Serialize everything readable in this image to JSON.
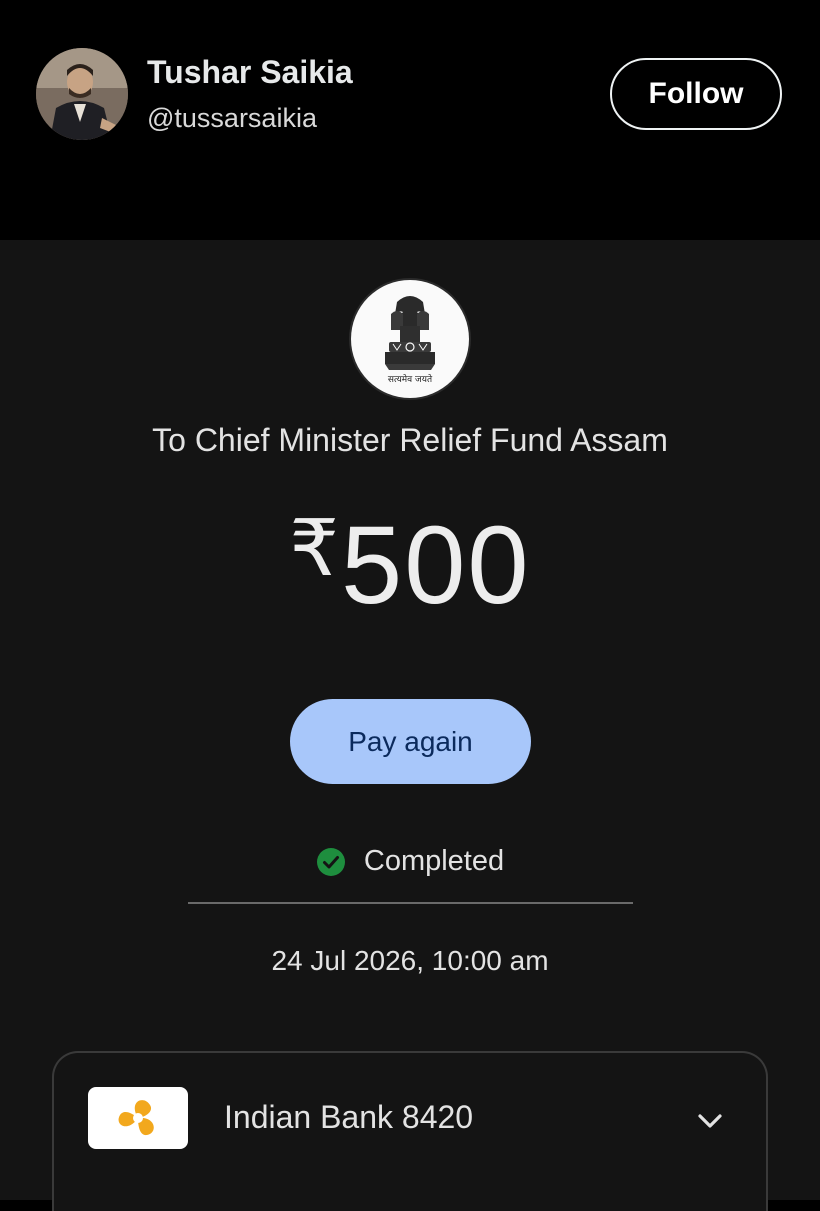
{
  "profile": {
    "name": "Tushar Saikia",
    "handle": "@tussarsaikia",
    "follow_label": "Follow"
  },
  "payment": {
    "emblem_icon": "state-emblem-icon",
    "emblem_motto": "सत्यमेव जयते",
    "payee": "To Chief Minister Relief Fund Assam",
    "currency_symbol": "₹",
    "amount": "500",
    "pay_again_label": "Pay again",
    "status_icon": "check-circle-icon",
    "status": "Completed",
    "status_color": "#1e8e3e",
    "datetime": "24 Jul 2026, 10:00 am"
  },
  "account": {
    "bank_icon": "indian-bank-logo-icon",
    "bank_name": "Indian Bank 8420",
    "expand_icon": "chevron-down-icon"
  },
  "colors": {
    "accent_button": "#a8c7fa",
    "bank_logo": "#f2a81d"
  }
}
